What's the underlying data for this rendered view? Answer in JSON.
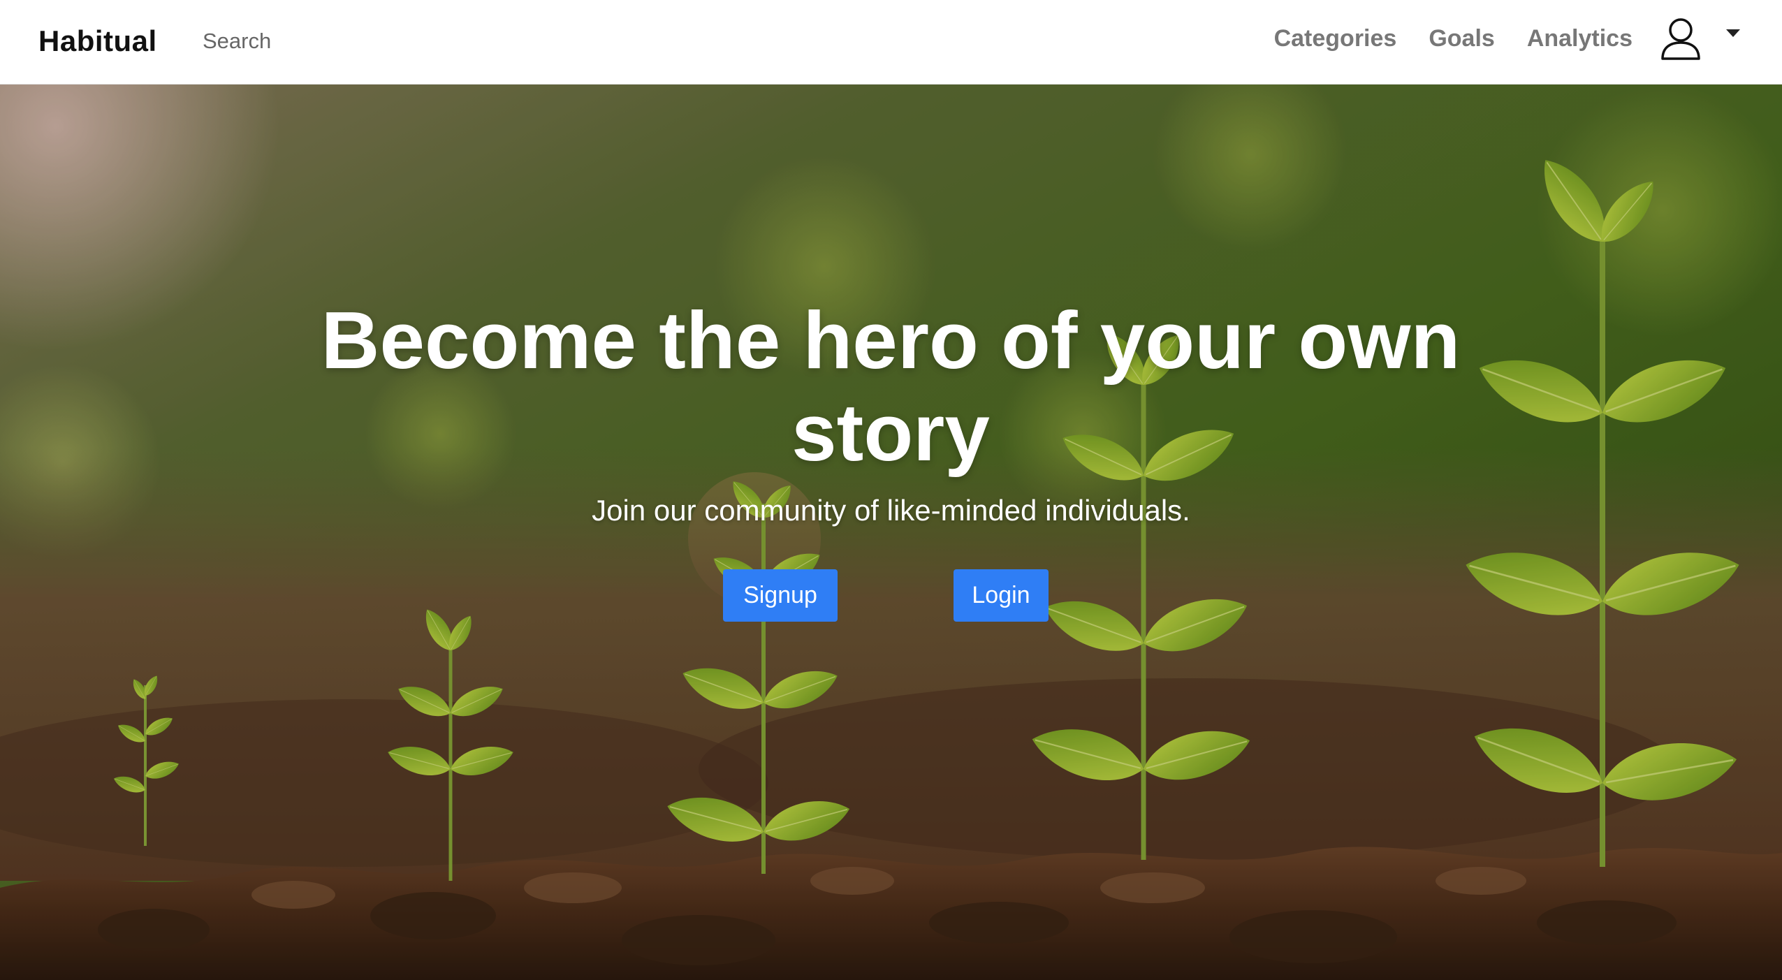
{
  "navbar": {
    "brand": "Habitual",
    "search_placeholder": "Search",
    "links": [
      "Categories",
      "Goals",
      "Analytics"
    ],
    "user_icon": "user-icon",
    "dropdown_icon": "caret-down-icon"
  },
  "hero": {
    "title": "Become the hero of your own story",
    "subtitle": "Join our community of like-minded individuals.",
    "signup_label": "Signup",
    "login_label": "Login",
    "accent_color": "#2f7ef5"
  }
}
